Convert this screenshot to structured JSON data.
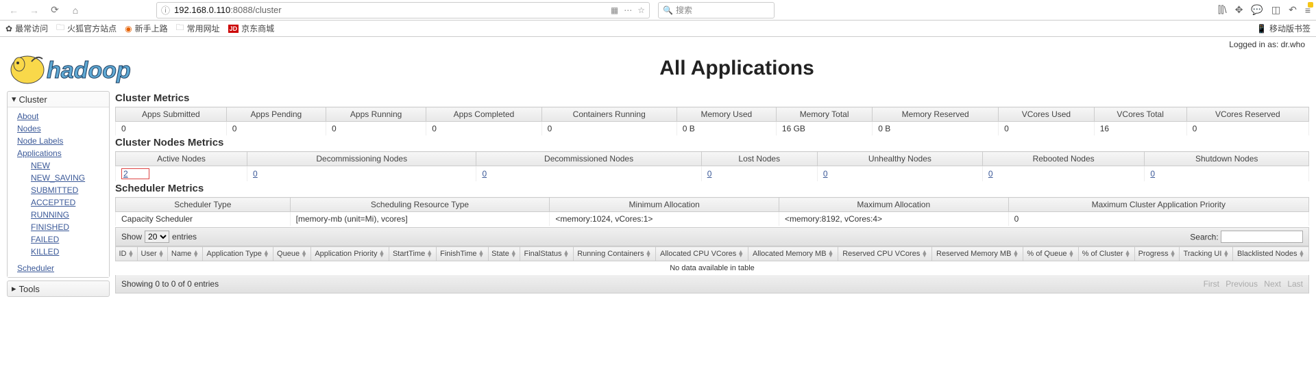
{
  "browser": {
    "url_prefix": "192.168.0.110",
    "url_suffix": ":8088/cluster",
    "search_placeholder": "搜索",
    "bookmarks": {
      "frequent": "最常访问",
      "firefox": "火狐官方站点",
      "newbie": "新手上路",
      "common": "常用网址",
      "jd_badge": "JD",
      "jd": "京东商城",
      "mobile": "移动版书签"
    }
  },
  "login_text": "Logged in as: dr.who",
  "page_title": "All Applications",
  "sidebar": {
    "cluster": "Cluster",
    "about": "About",
    "nodes": "Nodes",
    "node_labels": "Node Labels",
    "applications": "Applications",
    "new": "NEW",
    "new_saving": "NEW_SAVING",
    "submitted": "SUBMITTED",
    "accepted": "ACCEPTED",
    "running": "RUNNING",
    "finished": "FINISHED",
    "failed": "FAILED",
    "killed": "KILLED",
    "scheduler": "Scheduler",
    "tools": "Tools"
  },
  "cluster_metrics": {
    "title": "Cluster Metrics",
    "headers": [
      "Apps Submitted",
      "Apps Pending",
      "Apps Running",
      "Apps Completed",
      "Containers Running",
      "Memory Used",
      "Memory Total",
      "Memory Reserved",
      "VCores Used",
      "VCores Total",
      "VCores Reserved"
    ],
    "values": [
      "0",
      "0",
      "0",
      "0",
      "0",
      "0 B",
      "16 GB",
      "0 B",
      "0",
      "16",
      "0"
    ]
  },
  "nodes_metrics": {
    "title": "Cluster Nodes Metrics",
    "headers": [
      "Active Nodes",
      "Decommissioning Nodes",
      "Decommissioned Nodes",
      "Lost Nodes",
      "Unhealthy Nodes",
      "Rebooted Nodes",
      "Shutdown Nodes"
    ],
    "values": [
      "2",
      "0",
      "0",
      "0",
      "0",
      "0",
      "0"
    ]
  },
  "scheduler_metrics": {
    "title": "Scheduler Metrics",
    "headers": [
      "Scheduler Type",
      "Scheduling Resource Type",
      "Minimum Allocation",
      "Maximum Allocation",
      "Maximum Cluster Application Priority"
    ],
    "values": [
      "Capacity Scheduler",
      "[memory-mb (unit=Mi), vcores]",
      "<memory:1024, vCores:1>",
      "<memory:8192, vCores:4>",
      "0"
    ]
  },
  "datatable": {
    "show": "Show",
    "entries": "entries",
    "page_size": "20",
    "search_label": "Search:",
    "columns": [
      "ID",
      "User",
      "Name",
      "Application Type",
      "Queue",
      "Application Priority",
      "StartTime",
      "FinishTime",
      "State",
      "FinalStatus",
      "Running Containers",
      "Allocated CPU VCores",
      "Allocated Memory MB",
      "Reserved CPU VCores",
      "Reserved Memory MB",
      "% of Queue",
      "% of Cluster",
      "Progress",
      "Tracking UI",
      "Blacklisted Nodes"
    ],
    "nodata": "No data available in table",
    "info": "Showing 0 to 0 of 0 entries",
    "first": "First",
    "prev": "Previous",
    "next": "Next",
    "last": "Last"
  }
}
